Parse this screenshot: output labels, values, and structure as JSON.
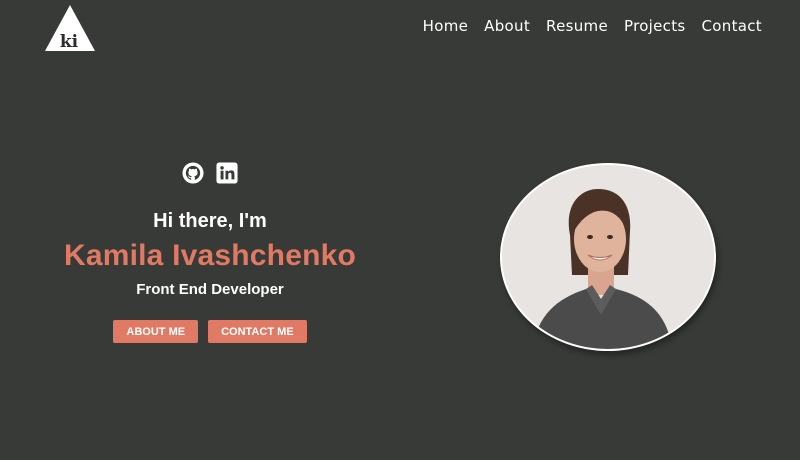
{
  "logo": {
    "text": "ki",
    "icon": "triangle-logo-icon"
  },
  "nav": [
    "Home",
    "About",
    "Resume",
    "Projects",
    "Contact"
  ],
  "socials": [
    {
      "icon": "github-icon"
    },
    {
      "icon": "linkedin-icon"
    }
  ],
  "hero": {
    "greeting": "Hi there, I'm",
    "name": "Kamila Ivashchenko",
    "role": "Front End Developer",
    "buttons": [
      "ABOUT ME",
      "CONTACT ME"
    ]
  },
  "colors": {
    "background": "#373a36",
    "accent": "#e07a64",
    "text": "#ffffff"
  }
}
